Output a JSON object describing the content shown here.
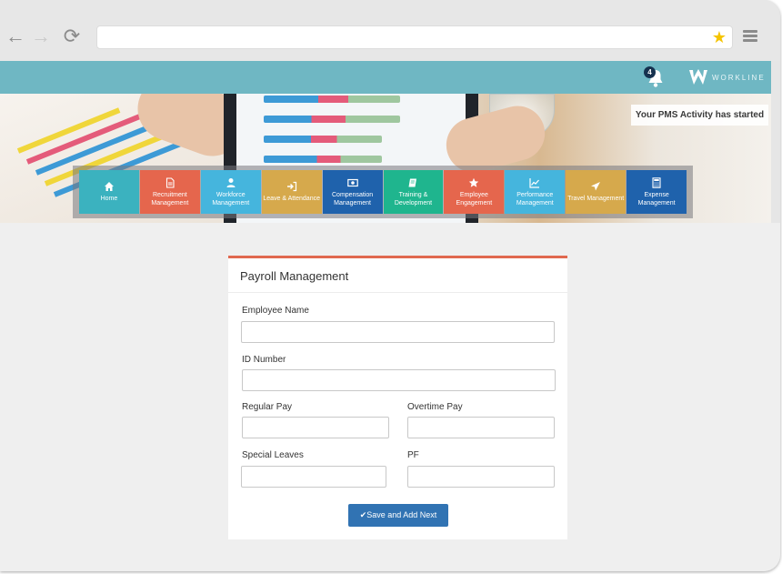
{
  "browser": {
    "back_glyph": "←",
    "forward_glyph": "→",
    "reload_glyph": "⟳",
    "address_value": "",
    "star_glyph": "★",
    "icons": [
      "back-arrow-icon",
      "forward-arrow-icon",
      "reload-icon",
      "star-icon",
      "hamburger-menu-icon"
    ]
  },
  "header": {
    "notification_count": "4",
    "logo_text": "WORKLINE",
    "bar_color": "#6fb7c3"
  },
  "hero": {
    "activity_message": "Your PMS Activity has started"
  },
  "modules": [
    {
      "label": "Home",
      "icon": "home-icon",
      "color": "#3bb2bf"
    },
    {
      "label": "Recruitment Management",
      "icon": "document-icon",
      "color": "#e5664d"
    },
    {
      "label": "Workforce Management",
      "icon": "user-icon",
      "color": "#45b5dd"
    },
    {
      "label": "Leave & Attendance",
      "icon": "sign-in-icon",
      "color": "#d6a94c"
    },
    {
      "label": "Compensation Management",
      "icon": "money-icon",
      "color": "#1f62ac"
    },
    {
      "label": "Training & Development",
      "icon": "book-icon",
      "color": "#1fb58e"
    },
    {
      "label": "Employee Engagement",
      "icon": "star-icon",
      "color": "#e5664d"
    },
    {
      "label": "Performance Management",
      "icon": "line-chart-icon",
      "color": "#45b5dd"
    },
    {
      "label": "Travel Management",
      "icon": "plane-icon",
      "color": "#d6a94c"
    },
    {
      "label": "Expense Management",
      "icon": "calculator-icon",
      "color": "#1f62ac"
    }
  ],
  "form": {
    "title": "Payroll Management",
    "accent_color": "#e0684f",
    "fields": {
      "employee_name": {
        "label": "Employee Name",
        "value": ""
      },
      "id_number": {
        "label": "ID Number",
        "value": ""
      },
      "regular_pay": {
        "label": "Regular Pay",
        "value": ""
      },
      "overtime_pay": {
        "label": "Overtime Pay",
        "value": ""
      },
      "special_leaves": {
        "label": "Special Leaves",
        "value": ""
      },
      "pf": {
        "label": "PF",
        "value": ""
      }
    },
    "submit_label": "✔Save and Add Next",
    "submit_color": "#3173b3"
  }
}
